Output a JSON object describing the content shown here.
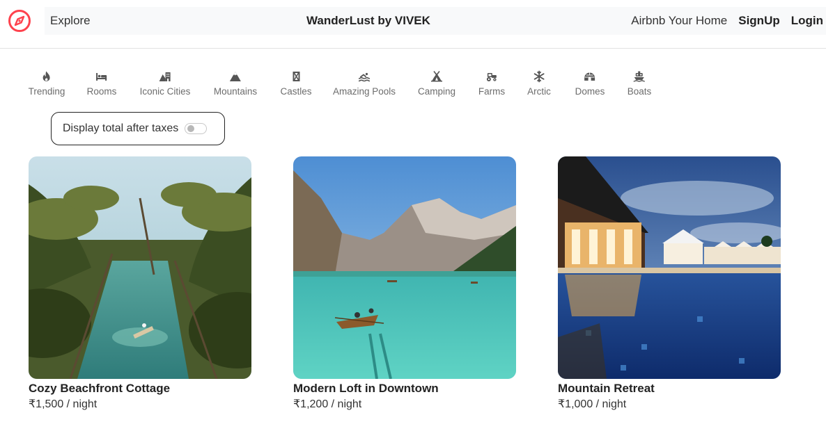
{
  "navbar": {
    "explore": "Explore",
    "brand": "WanderLust by VIVEK",
    "airbnb_home": "Airbnb Your Home",
    "signup": "SignUp",
    "login": "Login",
    "accent_color": "#fe424d"
  },
  "filters": [
    {
      "label": "Trending",
      "icon": "fire-icon"
    },
    {
      "label": "Rooms",
      "icon": "bed-icon"
    },
    {
      "label": "Iconic Cities",
      "icon": "mountain-city-icon"
    },
    {
      "label": "Mountains",
      "icon": "mountain-icon"
    },
    {
      "label": "Castles",
      "icon": "fort-icon"
    },
    {
      "label": "Amazing Pools",
      "icon": "person-swimming-icon"
    },
    {
      "label": "Camping",
      "icon": "campground-icon"
    },
    {
      "label": "Farms",
      "icon": "tractor-icon"
    },
    {
      "label": "Arctic",
      "icon": "snowflake-icon"
    },
    {
      "label": "Domes",
      "icon": "igloo-icon"
    },
    {
      "label": "Boats",
      "icon": "ferry-icon"
    }
  ],
  "tax_toggle": {
    "label": "Display total after taxes",
    "enabled": false
  },
  "listings": [
    {
      "title": "Cozy Beachfront Cottage",
      "price": "₹1,500 / night"
    },
    {
      "title": "Modern Loft in Downtown",
      "price": "₹1,200 / night"
    },
    {
      "title": "Mountain Retreat",
      "price": "₹1,000 / night"
    }
  ]
}
